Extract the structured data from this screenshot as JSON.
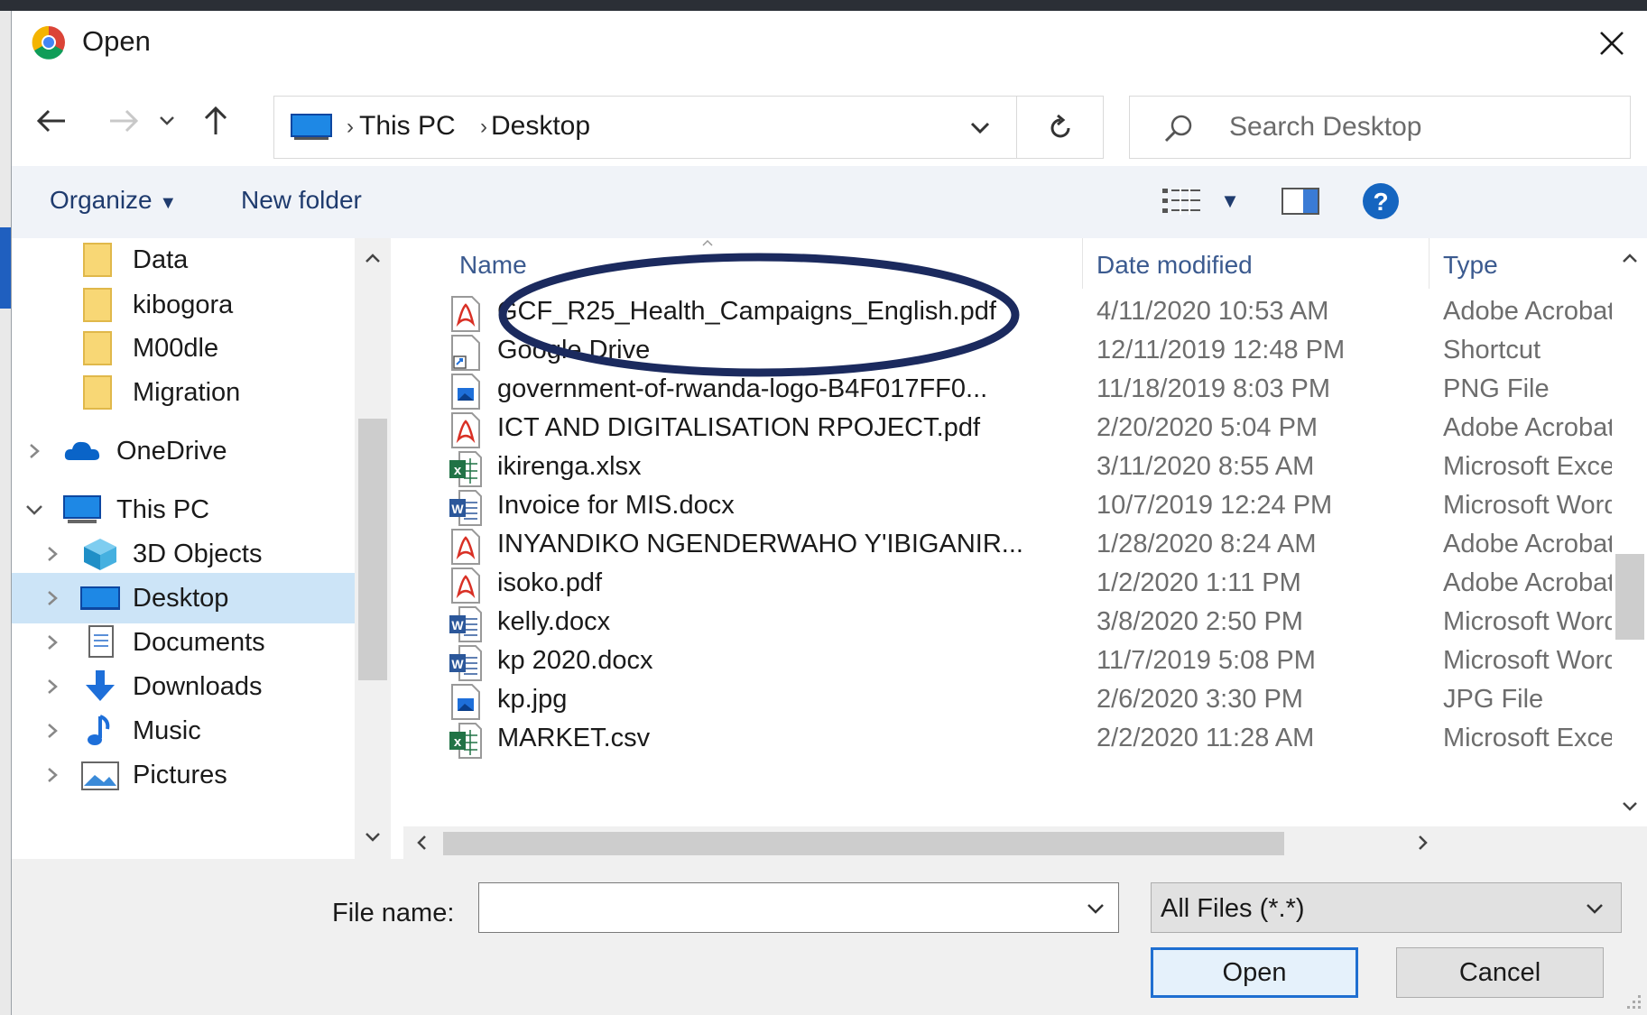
{
  "window": {
    "title": "Open",
    "app_icon": "chrome-icon"
  },
  "address": {
    "crumbs": [
      "This PC",
      "Desktop"
    ],
    "search_placeholder": "Search Desktop"
  },
  "toolbar": {
    "organize_label": "Organize",
    "new_folder_label": "New folder"
  },
  "nav_pane": {
    "items": [
      {
        "label": "Data",
        "icon": "folder-icon"
      },
      {
        "label": "kibogora",
        "icon": "folder-icon"
      },
      {
        "label": "M00dle",
        "icon": "folder-icon"
      },
      {
        "label": "Migration",
        "icon": "folder-icon"
      },
      {
        "label": "OneDrive",
        "icon": "cloud-icon"
      },
      {
        "label": "This PC",
        "icon": "computer-icon"
      },
      {
        "label": "3D Objects",
        "icon": "cube-icon"
      },
      {
        "label": "Desktop",
        "icon": "desktop-icon"
      },
      {
        "label": "Documents",
        "icon": "documents-icon"
      },
      {
        "label": "Downloads",
        "icon": "download-icon"
      },
      {
        "label": "Music",
        "icon": "music-icon"
      },
      {
        "label": "Pictures",
        "icon": "pictures-icon"
      }
    ],
    "selected": "Desktop"
  },
  "file_list": {
    "columns": [
      "Name",
      "Date modified",
      "Type"
    ],
    "rows": [
      {
        "name": "GCF_R25_Health_Campaigns_English.pdf",
        "date": "4/11/2020 10:53 AM",
        "type": "Adobe Acrobat",
        "icon": "pdf"
      },
      {
        "name": "Google Drive",
        "date": "12/11/2019 12:48 PM",
        "type": "Shortcut",
        "icon": "shortcut"
      },
      {
        "name": "government-of-rwanda-logo-B4F017FF0...",
        "date": "11/18/2019 8:03 PM",
        "type": "PNG File",
        "icon": "image"
      },
      {
        "name": "ICT AND DIGITALISATION RPOJECT.pdf",
        "date": "2/20/2020 5:04 PM",
        "type": "Adobe Acrobat",
        "icon": "pdf"
      },
      {
        "name": "ikirenga.xlsx",
        "date": "3/11/2020 8:55 AM",
        "type": "Microsoft Excel",
        "icon": "excel"
      },
      {
        "name": "Invoice for MIS.docx",
        "date": "10/7/2019 12:24 PM",
        "type": "Microsoft Word",
        "icon": "word"
      },
      {
        "name": "INYANDIKO NGENDERWAHO Y'IBIGANIR...",
        "date": "1/28/2020 8:24 AM",
        "type": "Adobe Acrobat",
        "icon": "pdf"
      },
      {
        "name": "isoko.pdf",
        "date": "1/2/2020 1:11 PM",
        "type": "Adobe Acrobat",
        "icon": "pdf"
      },
      {
        "name": "kelly.docx",
        "date": "3/8/2020 2:50 PM",
        "type": "Microsoft Word",
        "icon": "word"
      },
      {
        "name": "kp 2020.docx",
        "date": "11/7/2019 5:08 PM",
        "type": "Microsoft Word",
        "icon": "word"
      },
      {
        "name": "kp.jpg",
        "date": "2/6/2020 3:30 PM",
        "type": "JPG File",
        "icon": "image"
      },
      {
        "name": "MARKET.csv",
        "date": "2/2/2020 11:28 AM",
        "type": "Microsoft Excel",
        "icon": "excel"
      }
    ]
  },
  "footer": {
    "file_name_label": "File name:",
    "file_name_value": "",
    "filter_value": "All Files (*.*)",
    "open_label": "Open",
    "cancel_label": "Cancel"
  },
  "colors": {
    "accent": "#1f6fd1",
    "selection": "#cce4f7",
    "annotation": "#1b2a5e",
    "pdf": "#d93025",
    "word": "#2b579a",
    "excel": "#217346"
  }
}
